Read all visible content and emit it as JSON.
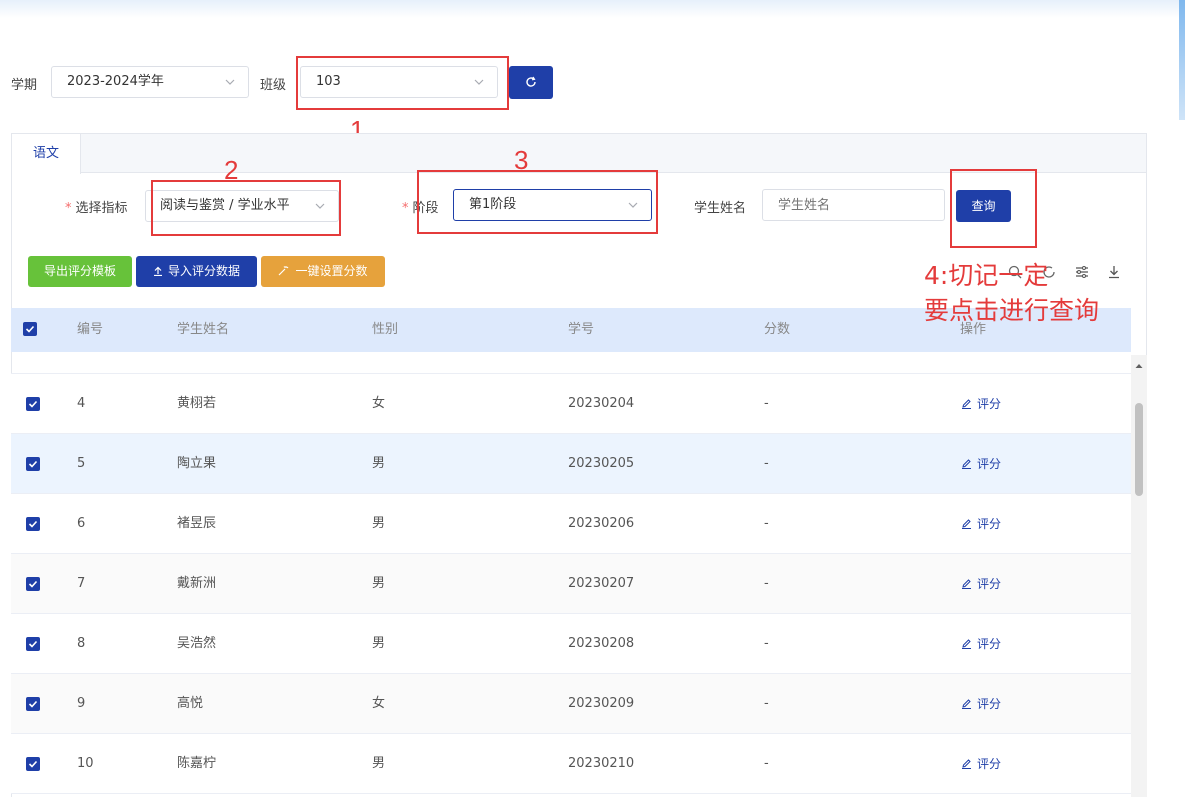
{
  "filters": {
    "term_label": "学期",
    "term_value": "2023-2024学年",
    "class_label": "班级",
    "class_value": "103"
  },
  "tabs": [
    "语文"
  ],
  "criteria": {
    "indicator_label": "选择指标",
    "indicator_value": "阅读与鉴赏 / 学业水平",
    "stage_label": "阶段",
    "stage_value": "第1阶段",
    "name_label": "学生姓名",
    "name_placeholder": "学生姓名",
    "query_button": "查询"
  },
  "actions": {
    "export_template": "导出评分模板",
    "import_data": "导入评分数据",
    "one_click": "一键设置分数"
  },
  "annotations": {
    "n1": "1",
    "n2": "2",
    "n3": "3",
    "note_line1": "4:切记一定",
    "note_line2": "要点击进行查询"
  },
  "table": {
    "headers": [
      "编号",
      "学生姓名",
      "性别",
      "学号",
      "分数",
      "操作"
    ],
    "rows": [
      {
        "no": "4",
        "name": "黄栩若",
        "gender": "女",
        "sid": "20230204",
        "score": "-",
        "op": "评分"
      },
      {
        "no": "5",
        "name": "陶立果",
        "gender": "男",
        "sid": "20230205",
        "score": "-",
        "op": "评分"
      },
      {
        "no": "6",
        "name": "褚昱辰",
        "gender": "男",
        "sid": "20230206",
        "score": "-",
        "op": "评分"
      },
      {
        "no": "7",
        "name": "戴新洲",
        "gender": "男",
        "sid": "20230207",
        "score": "-",
        "op": "评分"
      },
      {
        "no": "8",
        "name": "吴浩然",
        "gender": "男",
        "sid": "20230208",
        "score": "-",
        "op": "评分"
      },
      {
        "no": "9",
        "name": "高悦",
        "gender": "女",
        "sid": "20230209",
        "score": "-",
        "op": "评分"
      },
      {
        "no": "10",
        "name": "陈嘉柠",
        "gender": "男",
        "sid": "20230210",
        "score": "-",
        "op": "评分"
      }
    ]
  },
  "colors": {
    "primary": "#1f3fa8",
    "green": "#67c23a",
    "orange": "#e6a23c",
    "annotation_red": "#e43b3b"
  }
}
